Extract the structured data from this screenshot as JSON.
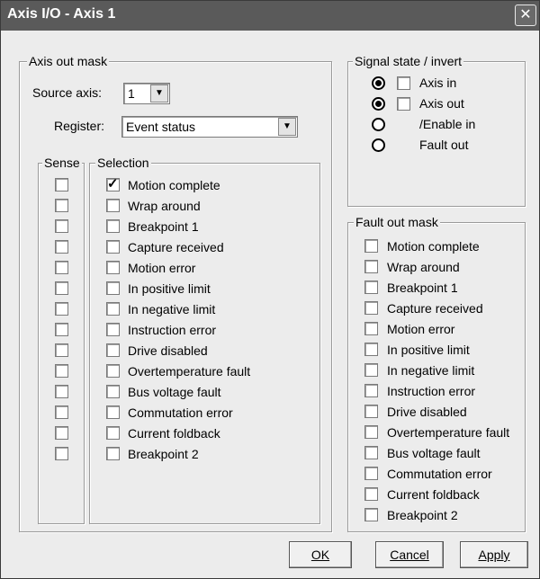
{
  "window": {
    "title": "Axis I/O - Axis 1",
    "close_glyph": "✕"
  },
  "axis_out_mask": {
    "legend": "Axis out mask",
    "source_axis_label": "Source axis:",
    "source_axis_value": "1",
    "register_label": "Register:",
    "register_value": "Event status",
    "sense_legend": "Sense",
    "selection_legend": "Selection",
    "items": [
      {
        "label": "Motion complete",
        "sense": false,
        "selected": true
      },
      {
        "label": "Wrap around",
        "sense": false,
        "selected": false
      },
      {
        "label": "Breakpoint 1",
        "sense": false,
        "selected": false
      },
      {
        "label": "Capture received",
        "sense": false,
        "selected": false
      },
      {
        "label": "Motion error",
        "sense": false,
        "selected": false
      },
      {
        "label": "In positive limit",
        "sense": false,
        "selected": false
      },
      {
        "label": "In negative limit",
        "sense": false,
        "selected": false
      },
      {
        "label": "Instruction error",
        "sense": false,
        "selected": false
      },
      {
        "label": "Drive disabled",
        "sense": false,
        "selected": false
      },
      {
        "label": "Overtemperature fault",
        "sense": false,
        "selected": false
      },
      {
        "label": "Bus voltage fault",
        "sense": false,
        "selected": false
      },
      {
        "label": "Commutation error",
        "sense": false,
        "selected": false
      },
      {
        "label": "Current foldback",
        "sense": false,
        "selected": false
      },
      {
        "label": "Breakpoint 2",
        "sense": false,
        "selected": false
      }
    ]
  },
  "signal_state": {
    "legend": "Signal state / invert",
    "rows": [
      {
        "label": "Axis in",
        "state_on": true,
        "invert_checkbox": true,
        "inverted": false
      },
      {
        "label": "Axis out",
        "state_on": true,
        "invert_checkbox": true,
        "inverted": false
      },
      {
        "label": "/Enable in",
        "state_on": false,
        "invert_checkbox": false
      },
      {
        "label": "Fault out",
        "state_on": false,
        "invert_checkbox": false
      }
    ]
  },
  "fault_out_mask": {
    "legend": "Fault out mask",
    "items": [
      {
        "label": "Motion complete",
        "checked": false
      },
      {
        "label": "Wrap around",
        "checked": false
      },
      {
        "label": "Breakpoint 1",
        "checked": false
      },
      {
        "label": "Capture received",
        "checked": false
      },
      {
        "label": "Motion error",
        "checked": false
      },
      {
        "label": "In positive limit",
        "checked": false
      },
      {
        "label": "In negative limit",
        "checked": false
      },
      {
        "label": "Instruction error",
        "checked": false
      },
      {
        "label": "Drive disabled",
        "checked": false
      },
      {
        "label": "Overtemperature fault",
        "checked": false
      },
      {
        "label": "Bus voltage fault",
        "checked": false
      },
      {
        "label": "Commutation error",
        "checked": false
      },
      {
        "label": "Current foldback",
        "checked": false
      },
      {
        "label": "Breakpoint 2",
        "checked": false
      }
    ]
  },
  "buttons": {
    "ok": "OK",
    "cancel": "Cancel",
    "apply": "Apply"
  }
}
